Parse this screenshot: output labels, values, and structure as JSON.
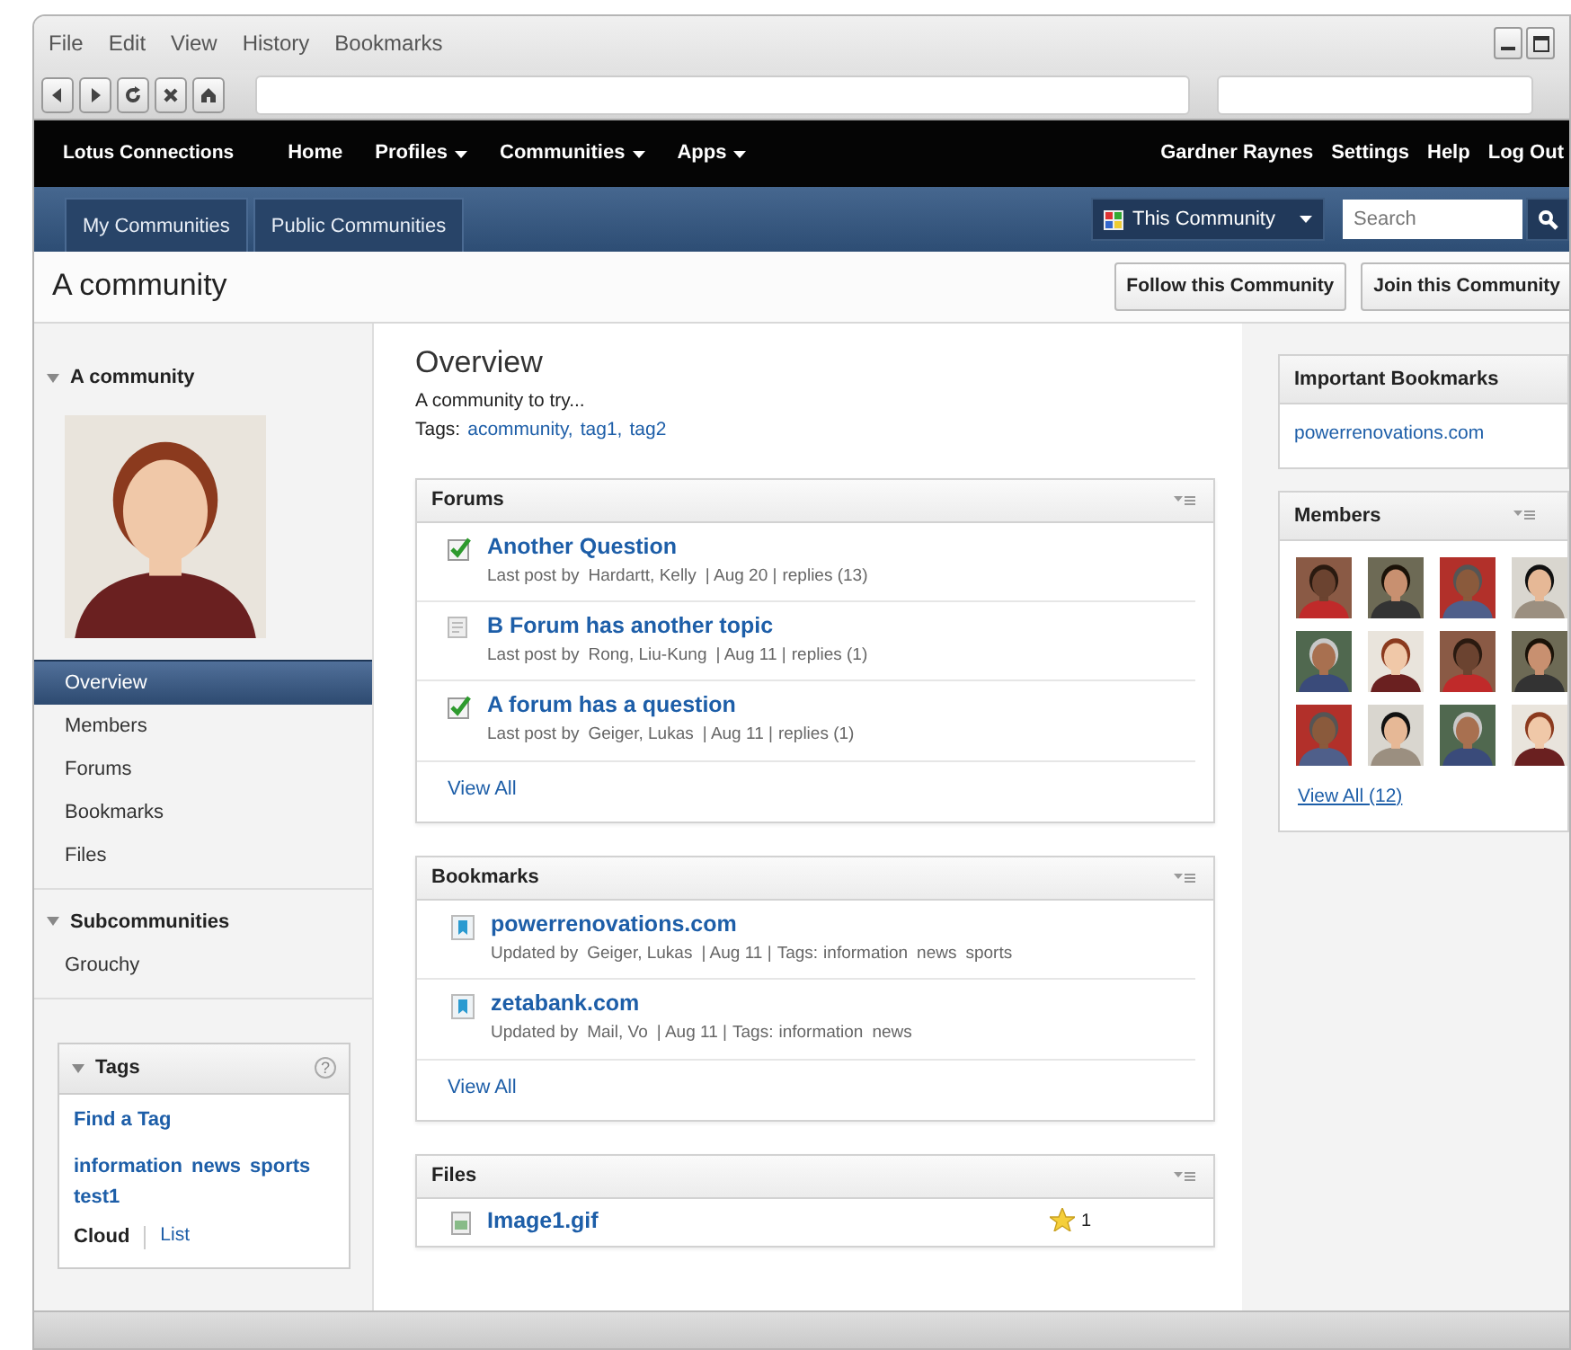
{
  "browser": {
    "menu": [
      "File",
      "Edit",
      "View",
      "History",
      "Bookmarks"
    ]
  },
  "navbar": {
    "brand": "Lotus Connections",
    "links": [
      {
        "label": "Home",
        "dropdown": false
      },
      {
        "label": "Profiles",
        "dropdown": true
      },
      {
        "label": "Communities",
        "dropdown": true
      },
      {
        "label": "Apps",
        "dropdown": true
      }
    ],
    "user_links": [
      "Gardner Raynes",
      "Settings",
      "Help",
      "Log Out"
    ]
  },
  "tabs": [
    {
      "label": "My Communities"
    },
    {
      "label": "Public Communities"
    }
  ],
  "scope_search": {
    "scope": "This Community",
    "placeholder": "Search"
  },
  "page_title": "A community",
  "actions": [
    "Follow this Community",
    "Join this Community"
  ],
  "sidebar": {
    "title": "A community",
    "nav": [
      {
        "label": "Overview",
        "selected": true
      },
      {
        "label": "Members",
        "selected": false
      },
      {
        "label": "Forums",
        "selected": false
      },
      {
        "label": "Bookmarks",
        "selected": false
      },
      {
        "label": "Files",
        "selected": false
      }
    ],
    "subcommunities": {
      "title": "Subcommunities",
      "items": [
        "Grouchy"
      ]
    },
    "tags": {
      "title": "Tags",
      "help": "?",
      "find": "Find a Tag",
      "tags": [
        "information",
        "news",
        "sports",
        "test1"
      ],
      "views": [
        {
          "label": "Cloud",
          "selected": true
        },
        {
          "label": "List",
          "selected": false
        }
      ]
    }
  },
  "overview": {
    "title": "Overview",
    "description": "A community to try...",
    "tags_label": "Tags:",
    "separator": ",",
    "tags": [
      "acommunity",
      "tag1",
      "tag2"
    ]
  },
  "forums": {
    "title": "Forums",
    "items": [
      {
        "kind": "answered",
        "title": "Another Question",
        "by_label": "Last post by",
        "author": "Hardartt, Kelly",
        "date": "| Aug 20 |",
        "replies": "replies (13)"
      },
      {
        "kind": "topic",
        "title": "B Forum has another topic",
        "by_label": "Last post by",
        "author": "Rong, Liu-Kung",
        "date": "| Aug 11 |",
        "replies": "replies (1)"
      },
      {
        "kind": "answered",
        "title": "A forum has a question",
        "by_label": "Last post by",
        "author": "Geiger, Lukas",
        "date": "| Aug 11 |",
        "replies": "replies (1)"
      }
    ],
    "view_all": "View All"
  },
  "bookmarks": {
    "title": "Bookmarks",
    "items": [
      {
        "title": "powerrenovations.com",
        "by_label": "Updated by",
        "author": "Geiger, Lukas",
        "date": "| Aug 11 |",
        "tags_label": "Tags:",
        "tags": [
          "information",
          "news",
          "sports"
        ]
      },
      {
        "title": "zetabank.com",
        "by_label": "Updated by",
        "author": "Mail, Vo",
        "date": "| Aug 11 |",
        "tags_label": "Tags:",
        "tags": [
          "information",
          "news"
        ]
      }
    ],
    "view_all": "View All"
  },
  "files": {
    "title": "Files",
    "items": [
      {
        "name": "Image1.gif",
        "rating": "1"
      }
    ]
  },
  "important_bookmarks": {
    "title": "Important Bookmarks",
    "links": [
      "powerrenovations.com"
    ]
  },
  "members": {
    "title": "Members",
    "view_all": "View All (12)"
  }
}
